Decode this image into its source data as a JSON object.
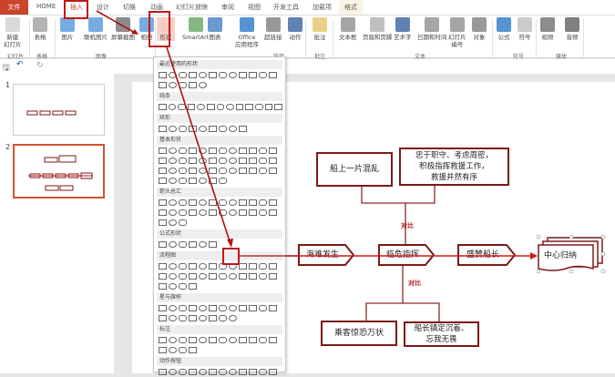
{
  "tabs": [
    "文件",
    "HOME",
    "插入",
    "设计",
    "切换",
    "动画",
    "幻灯片放映",
    "审阅",
    "视图",
    "开发工具",
    "加载项",
    "格式"
  ],
  "ribbon": {
    "buttons": [
      "新建\n幻灯片",
      "表格",
      "图片",
      "联机图片",
      "屏幕截图",
      "相册",
      "形状",
      "SmartArt",
      "图表",
      "Office\n应用程序",
      "超链接",
      "动作",
      "批注",
      "文本框",
      "页眉和页脚",
      "艺术字",
      "日期和时间",
      "幻灯片\n编号",
      "对象",
      "公式",
      "符号",
      "视频",
      "音频"
    ],
    "groups": [
      "幻灯片",
      "表格",
      "图像",
      "链接",
      "批注",
      "文本",
      "符号",
      "媒体"
    ]
  },
  "qat": {
    "save": "🖫",
    "undo": "↶",
    "redo": "↻"
  },
  "slides": [
    "1",
    "2"
  ],
  "gallery": {
    "sections": [
      "最近使用的形状",
      "线条",
      "矩形",
      "基本形状",
      "箭头总汇",
      "公式形状",
      "流程图",
      "星与旗帜",
      "标注",
      "动作按钮"
    ]
  },
  "diagram": {
    "top_left": "船上一片混乱",
    "top_right": [
      "忠于职守、考虑周密，",
      "积极指挥救援工作，",
      "救援井然有序"
    ],
    "contrast": "对比",
    "steps": [
      "海难发生",
      "临危指挥",
      "盛赞船长"
    ],
    "center": "中心归纳",
    "bottom_left": "乘客惊恐万状",
    "bottom_right": [
      "船长镇定沉着、",
      "忘我无畏"
    ]
  },
  "colors": {
    "accent": "#c9442a",
    "border": "#7b1a1a",
    "arrow": "#d01818"
  }
}
